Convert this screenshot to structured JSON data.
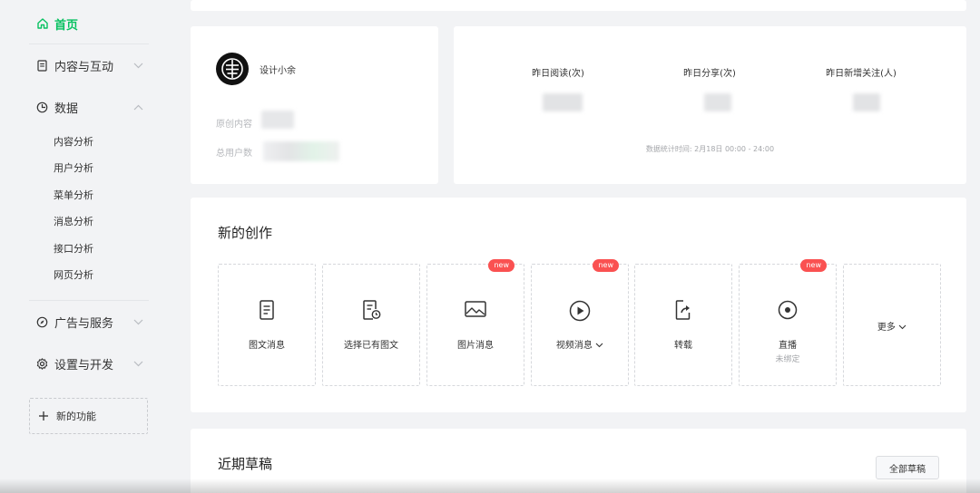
{
  "sidebar": {
    "home": "首页",
    "content_interact": "内容与互动",
    "data": "数据",
    "data_items": [
      "内容分析",
      "用户分析",
      "菜单分析",
      "消息分析",
      "接口分析",
      "网页分析"
    ],
    "ads_services": "广告与服务",
    "settings_dev": "设置与开发",
    "new_features": "新的功能"
  },
  "profile": {
    "nickname": "设计小余",
    "original_label": "原创内容",
    "total_users_label": "总用户数"
  },
  "stats": {
    "read_label": "昨日阅读(次)",
    "share_label": "昨日分享(次)",
    "follow_label": "昨日新增关注(人)",
    "note": "数据统计时间: 2月18日 00:00 - 24:00"
  },
  "create": {
    "title": "新的创作",
    "new_badge": "new",
    "tiles": {
      "article": "图文消息",
      "select_existing": "选择已有图文",
      "image_msg": "图片消息",
      "video_msg": "视频消息",
      "repost": "转载",
      "live": "直播",
      "live_sub": "未绑定",
      "more": "更多"
    }
  },
  "drafts": {
    "title": "近期草稿",
    "all_button": "全部草稿"
  },
  "colors": {
    "accent": "#07c160",
    "badge": "#fa5151"
  },
  "icons": {
    "home": "home-icon",
    "document": "document-icon",
    "clock": "pie-clock-icon",
    "compass": "compass-icon",
    "gear": "gear-icon",
    "plus": "plus-icon"
  }
}
